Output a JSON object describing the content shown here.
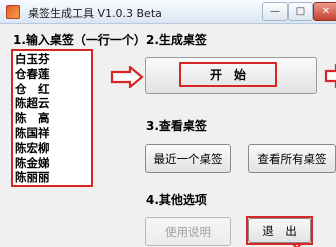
{
  "window": {
    "title": "桌签生成工具 V1.0.3 Beta",
    "min_label": "—",
    "max_label": "□",
    "close_label": "✕"
  },
  "sections": {
    "input_label": "1.输入桌签（一行一个）",
    "generate_label": "2.生成桌签",
    "view_label": "3.查看桌签",
    "other_label": "4.其他选项"
  },
  "names": [
    "白玉芬",
    "仓春莲",
    "仓　红",
    "陈超云",
    "陈　高",
    "陈国祥",
    "陈宏柳",
    "陈金娣",
    "陈丽丽"
  ],
  "buttons": {
    "start": "开　始",
    "recent": "最近一个桌签",
    "view_all": "查看所有桌签",
    "help": "使用说明",
    "exit": "退　出"
  },
  "colors": {
    "highlight": "#d62626"
  }
}
